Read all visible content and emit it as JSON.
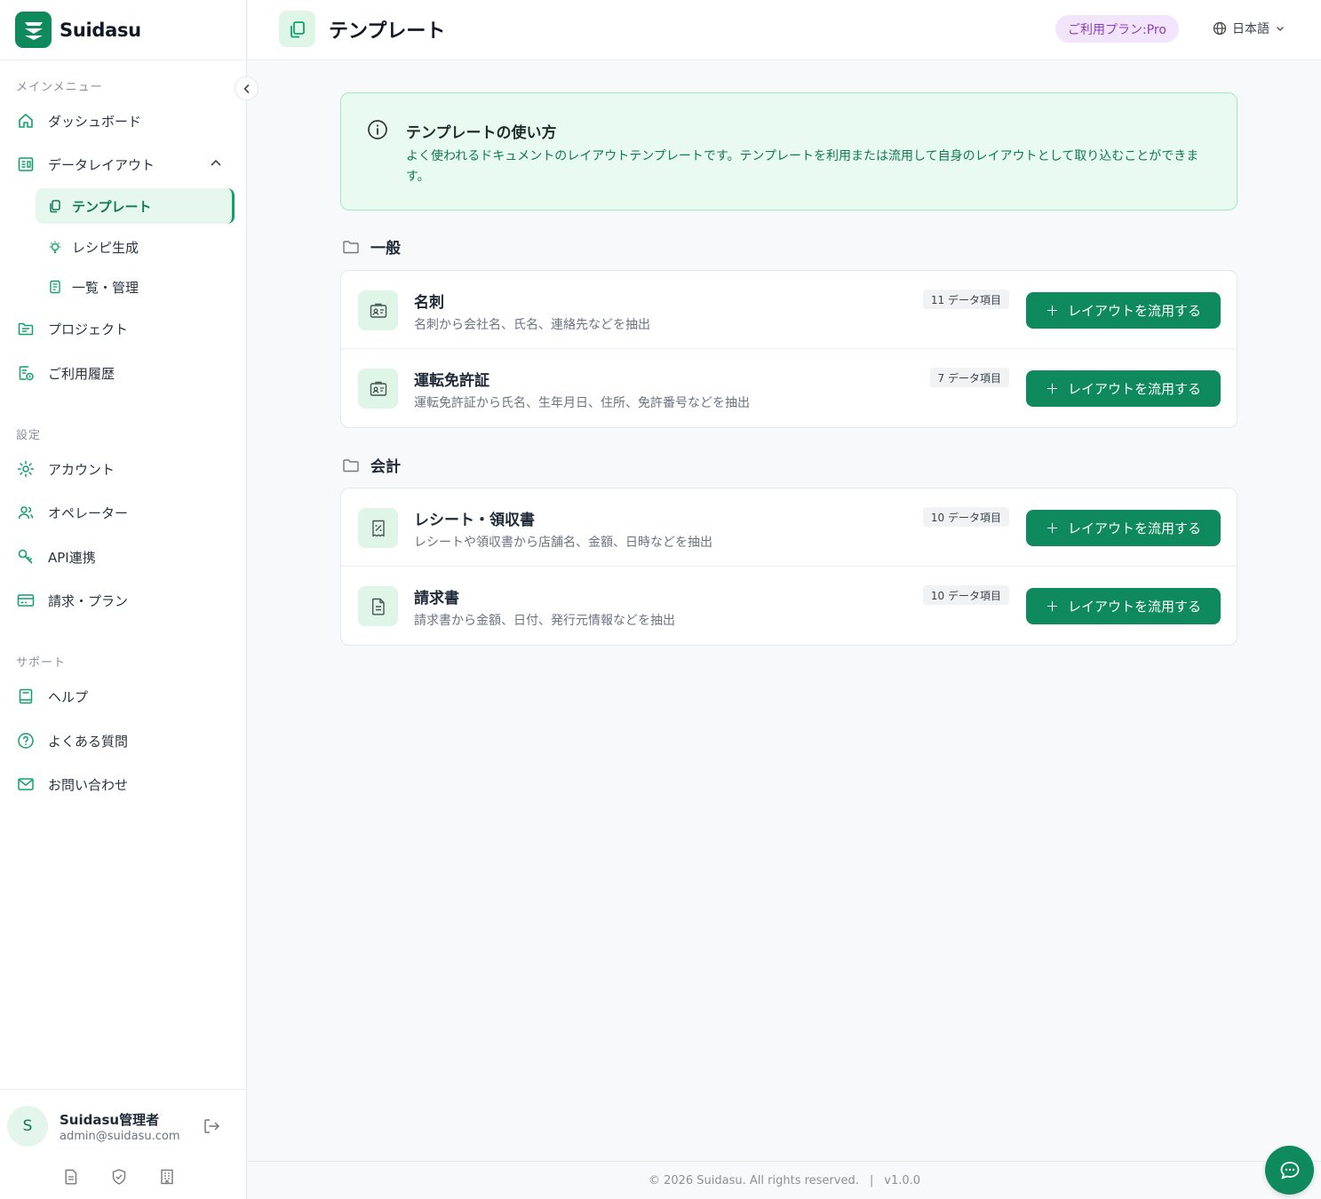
{
  "brand": {
    "name": "Suidasu",
    "color": "#0f8a5f"
  },
  "sidebar": {
    "main_label": "メインメニュー",
    "dashboard": "ダッシュボード",
    "data_layout": "データレイアウト",
    "sub": {
      "template": "テンプレート",
      "recipe": "レシピ生成",
      "list": "一覧・管理"
    },
    "project": "プロジェクト",
    "history": "ご利用履歴",
    "settings_label": "設定",
    "account": "アカウント",
    "operator": "オペレーター",
    "api": "API連携",
    "billing": "請求・プラン",
    "support_label": "サポート",
    "help": "ヘルプ",
    "faq": "よくある質問",
    "contact": "お問い合わせ"
  },
  "user": {
    "initial": "S",
    "name": "Suidasu管理者",
    "email": "admin@suidasu.com"
  },
  "header": {
    "title": "テンプレート",
    "plan": "ご利用プラン:Pro",
    "language": "日本語"
  },
  "info": {
    "title": "テンプレートの使い方",
    "text": "よく使われるドキュメントのレイアウトテンプレートです。テンプレートを利用または流用して自身のレイアウトとして取り込むことができます。"
  },
  "groups": [
    {
      "name": "一般",
      "items": [
        {
          "title": "名刺",
          "desc": "名刺から会社名、氏名、連絡先などを抽出",
          "count": "11 データ項目",
          "button": "レイアウトを流用する",
          "icon": "id-card-icon"
        },
        {
          "title": "運転免許証",
          "desc": "運転免許証から氏名、生年月日、住所、免許番号などを抽出",
          "count": "7 データ項目",
          "button": "レイアウトを流用する",
          "icon": "id-card-icon"
        }
      ]
    },
    {
      "name": "会計",
      "items": [
        {
          "title": "レシート・領収書",
          "desc": "レシートや領収書から店舗名、金額、日時などを抽出",
          "count": "10 データ項目",
          "button": "レイアウトを流用する",
          "icon": "receipt-icon"
        },
        {
          "title": "請求書",
          "desc": "請求書から金額、日付、発行元情報などを抽出",
          "count": "10 データ項目",
          "button": "レイアウトを流用する",
          "icon": "document-icon"
        }
      ]
    }
  ],
  "footer": {
    "copyright": "© 2026 Suidasu. All rights reserved.",
    "separator": "|",
    "version": "v1.0.0"
  }
}
